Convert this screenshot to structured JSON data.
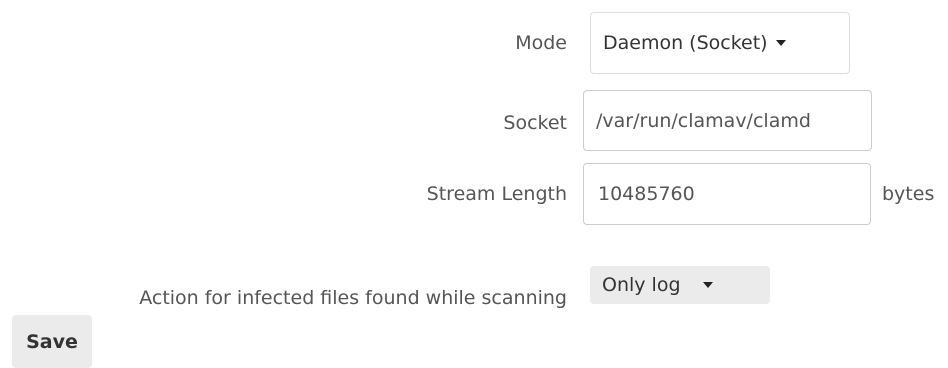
{
  "form": {
    "mode": {
      "label": "Mode",
      "value": "Daemon (Socket)"
    },
    "socket": {
      "label": "Socket",
      "value": "/var/run/clamav/clamd"
    },
    "stream_length": {
      "label": "Stream Length",
      "value": "10485760",
      "unit": "bytes"
    },
    "action": {
      "label": "Action for infected files found while scanning",
      "value": "Only log"
    },
    "save_label": "Save"
  }
}
